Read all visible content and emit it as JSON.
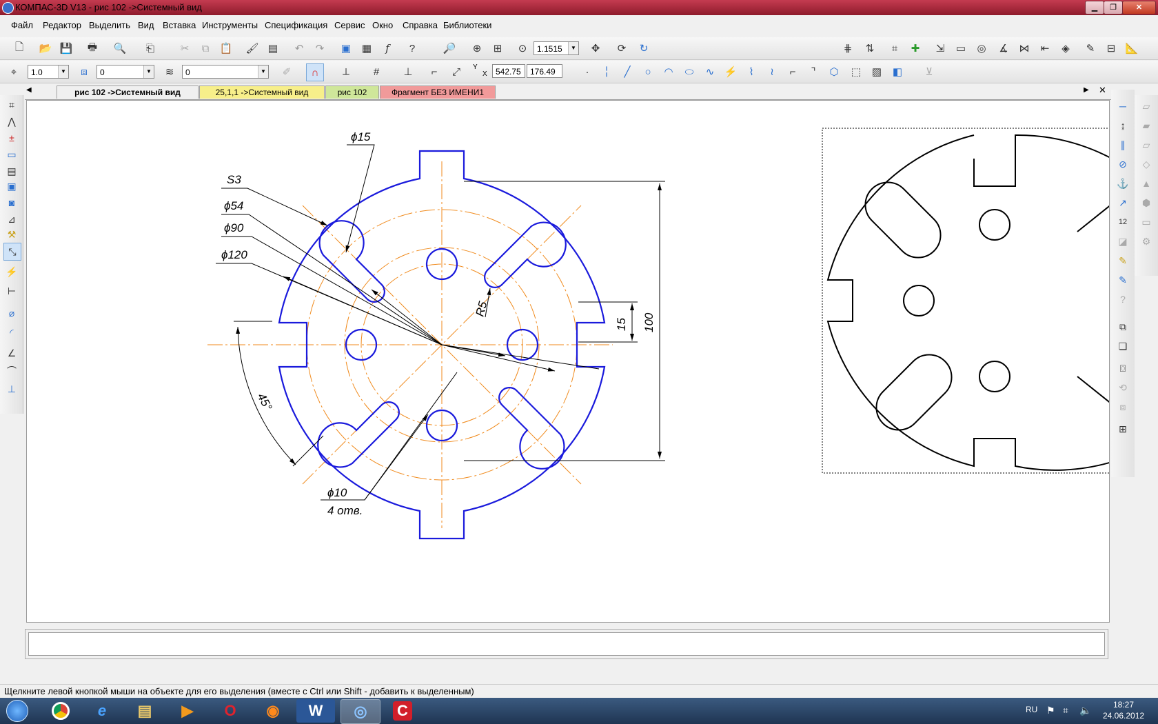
{
  "window": {
    "title": "КОМПАС-3D V13 - рис 102 ->Системный вид",
    "controls": {
      "minimize": "▁",
      "maximize": "❐",
      "close": "✕"
    }
  },
  "menu": [
    "Файл",
    "Редактор",
    "Выделить",
    "Вид",
    "Вставка",
    "Инструменты",
    "Спецификация",
    "Сервис",
    "Окно",
    "Справка",
    "Библиотеки"
  ],
  "toolbar": {
    "zoom_value": "1.1515",
    "line_scale": "1.0",
    "state_value": "0",
    "layer_value": "0",
    "coord_x": "542.75",
    "coord_y": "176.49",
    "coord_label_y": "Y",
    "coord_label_x": "X"
  },
  "tabs": [
    {
      "label": "рис 102 ->Системный вид",
      "active": true,
      "color": "#f0f0f0"
    },
    {
      "label": "25,1,1 ->Системный вид",
      "active": false,
      "color": "#f7ef8a"
    },
    {
      "label": "рис 102",
      "active": false,
      "color": "#cfe79a"
    },
    {
      "label": "Фрагмент БЕЗ ИМЕНИ1",
      "active": false,
      "color": "#f19a9a"
    }
  ],
  "drawing": {
    "dim_d15": "ϕ15",
    "dim_s3": "S3",
    "dim_d54": "ϕ54",
    "dim_d90": "ϕ90",
    "dim_d120": "ϕ120",
    "dim_r5": "R5",
    "dim_15": "15",
    "dim_100": "100",
    "dim_45": "45°",
    "dim_d10": "ϕ10",
    "dim_holes": "4 отв.",
    "colors": {
      "contour": "#1a1adc",
      "axis": "#f08a1c",
      "dimension": "#000000"
    }
  },
  "status": {
    "hint": "Щелкните левой кнопкой мыши на объекте для его выделения (вместе с Ctrl или Shift - добавить к выделенным)"
  },
  "taskbar": {
    "language": "RU",
    "time": "18:27",
    "date": "24.06.2012"
  }
}
